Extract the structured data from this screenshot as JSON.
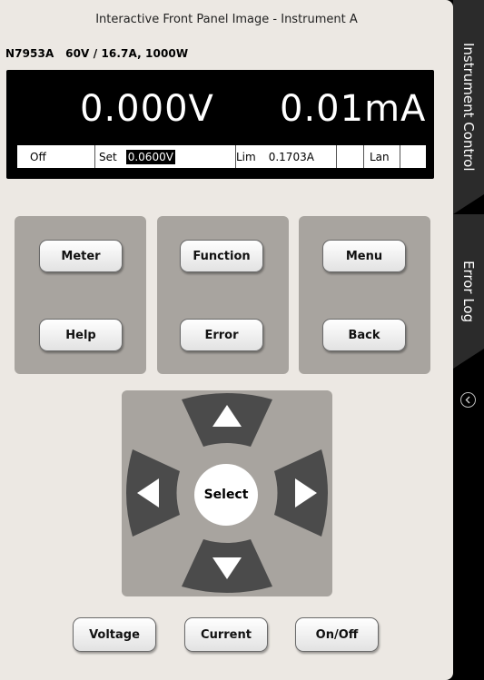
{
  "panel": {
    "title": "Interactive Front Panel Image - Instrument A",
    "model": "N7953A   60V / 16.7A, 1000W"
  },
  "display": {
    "voltage": "0.000V",
    "current": "0.01mA",
    "status": {
      "output": "Off",
      "set_label": "Set",
      "set_value": "0.0600V",
      "lim_label": "Lim",
      "lim_value": "0.1703A",
      "interface": "Lan"
    }
  },
  "buttons": {
    "meter": "Meter",
    "help": "Help",
    "function": "Function",
    "error": "Error",
    "menu": "Menu",
    "back": "Back",
    "select": "Select",
    "voltage": "Voltage",
    "current": "Current",
    "onoff": "On/Off"
  },
  "tabs": {
    "instrument_control": "Instrument Control",
    "error_log": "Error Log"
  },
  "icons": {
    "collapse": "chevron-left-icon"
  }
}
